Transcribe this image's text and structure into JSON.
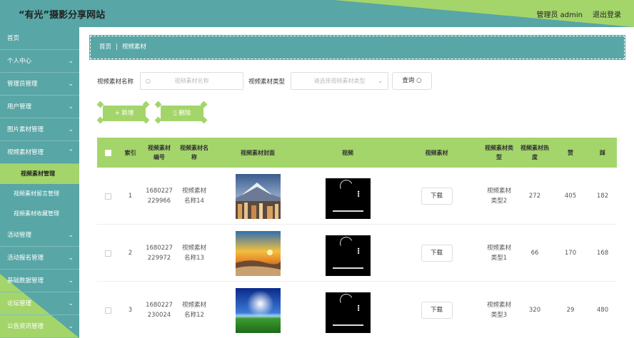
{
  "header": {
    "title": "“有光”摄影分享网站",
    "admin": "管理员 admin",
    "logout": "退出登录"
  },
  "sidebar": {
    "items": [
      {
        "label": "首页",
        "chevron": ""
      },
      {
        "label": "个人中心",
        "chevron": "⌄"
      },
      {
        "label": "管理员管理",
        "chevron": "⌄"
      },
      {
        "label": "用户管理",
        "chevron": "⌄"
      },
      {
        "label": "图片素材管理",
        "chevron": "⌄"
      },
      {
        "label": "视频素材管理",
        "chevron": "⌃"
      },
      {
        "label": "活动管理",
        "chevron": "⌄"
      },
      {
        "label": "活动报名管理",
        "chevron": "⌄"
      },
      {
        "label": "基础数据管理",
        "chevron": "⌄"
      },
      {
        "label": "论坛管理",
        "chevron": "⌄"
      },
      {
        "label": "公告资讯管理",
        "chevron": "⌄"
      }
    ],
    "sub_items": [
      {
        "label": "视频素材管理"
      },
      {
        "label": "视频素材留言管理"
      },
      {
        "label": "视频素材收藏管理"
      }
    ]
  },
  "breadcrumb": {
    "home": "首页",
    "sep": "|",
    "current": "视频素材"
  },
  "search": {
    "name_label": "视频素材名称",
    "name_placeholder": "视频素材名称",
    "type_label": "视频素材类型",
    "type_placeholder": "请选择视频素材类型",
    "query_button": "查询"
  },
  "actions": {
    "add": "新增",
    "delete": "删除"
  },
  "table": {
    "headers": {
      "index": "索引",
      "number": "视频素材编号",
      "name": "视频素材名称",
      "cover": "视频素材封面",
      "video": "视频",
      "file": "视频素材",
      "type": "视频素材类型",
      "heat": "视频素材热度",
      "like": "赞",
      "dislike": "踩"
    },
    "rows": [
      {
        "index": "1",
        "number": "1680227229966",
        "name": "视频素材名称14",
        "download": "下载",
        "type": "视频素材类型2",
        "heat": "272",
        "like": "405",
        "dislike": "182"
      },
      {
        "index": "2",
        "number": "1680227229972",
        "name": "视频素材名称13",
        "download": "下载",
        "type": "视频素材类型1",
        "heat": "66",
        "like": "170",
        "dislike": "168"
      },
      {
        "index": "3",
        "number": "1680227230024",
        "name": "视频素材名称12",
        "download": "下载",
        "type": "视频素材类型3",
        "heat": "320",
        "like": "29",
        "dislike": "480"
      }
    ]
  },
  "colors": {
    "teal": "#58a6a6",
    "green": "#a4d56a"
  }
}
